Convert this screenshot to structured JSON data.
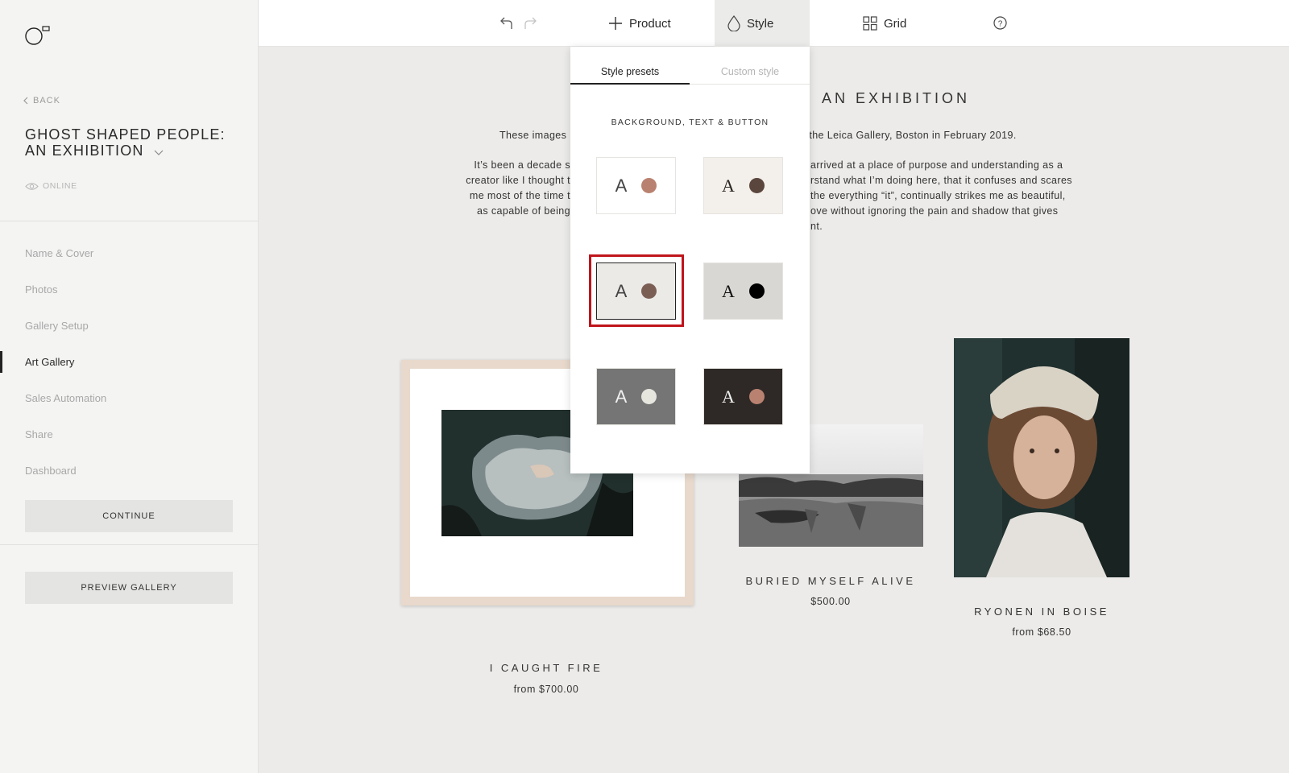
{
  "sidebar": {
    "back_label": "BACK",
    "gallery_title": "GHOST SHAPED PEOPLE: AN EXHIBITION",
    "status": "ONLINE",
    "nav": [
      {
        "label": "Name & Cover"
      },
      {
        "label": "Photos"
      },
      {
        "label": "Gallery Setup"
      },
      {
        "label": "Art Gallery"
      },
      {
        "label": "Sales Automation"
      },
      {
        "label": "Share"
      },
      {
        "label": "Dashboard"
      }
    ],
    "active_nav": "Art Gallery",
    "continue_label": "CONTINUE",
    "preview_label": "PREVIEW GALLERY"
  },
  "toolbar": {
    "product_label": "Product",
    "style_label": "Style",
    "grid_label": "Grid",
    "icons": [
      "undo-icon",
      "redo-icon",
      "plus-icon",
      "droplet-icon",
      "grid-icon",
      "help-icon"
    ]
  },
  "page": {
    "title_fragment": "AN EXHIBITION",
    "intro_line_left": "These images",
    "intro_line_right": "d at the Leica Gallery, Boston in February 2019.",
    "para_left": [
      "It’s been a decade s",
      "creator like I thought t",
      "me most of the time t",
      "as capable of being"
    ],
    "para_right": [
      "arrived at a place of purpose and understanding as a",
      "rstand what I’m doing here, that it confuses and scares",
      "the everything “it”, continually strikes me as beautiful,",
      "ove without ignoring the pain and shadow that gives",
      "nt."
    ]
  },
  "artworks": [
    {
      "title": "I CAUGHT FIRE",
      "price": "from $700.00"
    },
    {
      "title": "BURIED MYSELF ALIVE",
      "price": "$500.00"
    },
    {
      "title": "RYONEN IN BOISE",
      "price": "from $68.50"
    }
  ],
  "style_popover": {
    "tabs": [
      "Style presets",
      "Custom style"
    ],
    "active_tab": "Style presets",
    "section_label": "BACKGROUND, TEXT & BUTTON",
    "presets": [
      {
        "glyph": "A",
        "bg": "#ffffff",
        "text": "#444444",
        "dot": "#b98270",
        "font": "sans"
      },
      {
        "glyph": "A",
        "bg": "#f3efea",
        "text": "#2a2422",
        "dot": "#5a463d",
        "font": "serif"
      },
      {
        "glyph": "A",
        "bg": "#eceae7",
        "text": "#444444",
        "dot": "#7a5e54",
        "font": "sans",
        "selected": true
      },
      {
        "glyph": "A",
        "bg": "#d8d7d3",
        "text": "#111111",
        "dot": "#000000",
        "font": "serif"
      },
      {
        "glyph": "A",
        "bg": "#757575",
        "text": "#f0f0f0",
        "dot": "#e6e6df",
        "font": "sans"
      },
      {
        "glyph": "A",
        "bg": "#2e2927",
        "text": "#f2f2f2",
        "dot": "#b98270",
        "font": "serif"
      }
    ],
    "highlight_color": "#c0141b"
  }
}
